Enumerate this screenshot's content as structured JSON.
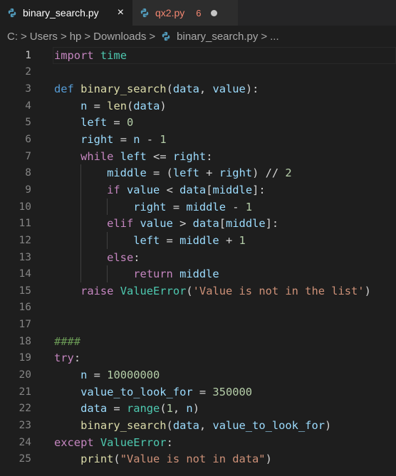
{
  "tabs": [
    {
      "label": "binary_search.py",
      "active": true,
      "close": "×"
    },
    {
      "label": "qx2.py",
      "active": false,
      "problems": "6",
      "modified": true
    }
  ],
  "breadcrumb": {
    "drive": "C:",
    "parts": [
      "Users",
      "hp",
      "Downloads",
      "binary_search.py",
      "..."
    ],
    "separator": ">"
  },
  "colors": {
    "keyword": "#569cd6",
    "control": "#c586c0",
    "function": "#dcdcaa",
    "variable": "#9cdcfe",
    "number": "#b5cea8",
    "string": "#ce9178",
    "class": "#4ec9b0",
    "comment": "#6a9955",
    "background": "#1e1e1e"
  },
  "icons": {
    "file_type": "python-icon"
  },
  "lines": [
    {
      "n": "1",
      "indent": 0,
      "tokens": [
        [
          "kc",
          "import"
        ],
        [
          "op",
          " "
        ],
        [
          "cl",
          "time"
        ]
      ]
    },
    {
      "n": "2",
      "indent": 0,
      "tokens": []
    },
    {
      "n": "3",
      "indent": 0,
      "tokens": [
        [
          "kw",
          "def"
        ],
        [
          "op",
          " "
        ],
        [
          "fn",
          "binary_search"
        ],
        [
          "op",
          "("
        ],
        [
          "vr",
          "data"
        ],
        [
          "op",
          ", "
        ],
        [
          "vr",
          "value"
        ],
        [
          "op",
          "):"
        ]
      ]
    },
    {
      "n": "4",
      "indent": 1,
      "tokens": [
        [
          "op",
          "    "
        ],
        [
          "vr",
          "n"
        ],
        [
          "op",
          " = "
        ],
        [
          "fn",
          "len"
        ],
        [
          "op",
          "("
        ],
        [
          "vr",
          "data"
        ],
        [
          "op",
          ")"
        ]
      ]
    },
    {
      "n": "5",
      "indent": 1,
      "tokens": [
        [
          "op",
          "    "
        ],
        [
          "vr",
          "left"
        ],
        [
          "op",
          " = "
        ],
        [
          "nm",
          "0"
        ]
      ]
    },
    {
      "n": "6",
      "indent": 1,
      "tokens": [
        [
          "op",
          "    "
        ],
        [
          "vr",
          "right"
        ],
        [
          "op",
          " = "
        ],
        [
          "vr",
          "n"
        ],
        [
          "op",
          " - "
        ],
        [
          "nm",
          "1"
        ]
      ]
    },
    {
      "n": "7",
      "indent": 1,
      "tokens": [
        [
          "op",
          "    "
        ],
        [
          "kc",
          "while"
        ],
        [
          "op",
          " "
        ],
        [
          "vr",
          "left"
        ],
        [
          "op",
          " <= "
        ],
        [
          "vr",
          "right"
        ],
        [
          "op",
          ":"
        ]
      ]
    },
    {
      "n": "8",
      "indent": 2,
      "tokens": [
        [
          "op",
          "        "
        ],
        [
          "vr",
          "middle"
        ],
        [
          "op",
          " = ("
        ],
        [
          "vr",
          "left"
        ],
        [
          "op",
          " + "
        ],
        [
          "vr",
          "right"
        ],
        [
          "op",
          ") // "
        ],
        [
          "nm",
          "2"
        ]
      ]
    },
    {
      "n": "9",
      "indent": 2,
      "tokens": [
        [
          "op",
          "        "
        ],
        [
          "kc",
          "if"
        ],
        [
          "op",
          " "
        ],
        [
          "vr",
          "value"
        ],
        [
          "op",
          " < "
        ],
        [
          "vr",
          "data"
        ],
        [
          "op",
          "["
        ],
        [
          "vr",
          "middle"
        ],
        [
          "op",
          "]:"
        ]
      ]
    },
    {
      "n": "10",
      "indent": 3,
      "tokens": [
        [
          "op",
          "            "
        ],
        [
          "vr",
          "right"
        ],
        [
          "op",
          " = "
        ],
        [
          "vr",
          "middle"
        ],
        [
          "op",
          " - "
        ],
        [
          "nm",
          "1"
        ]
      ]
    },
    {
      "n": "11",
      "indent": 2,
      "tokens": [
        [
          "op",
          "        "
        ],
        [
          "kc",
          "elif"
        ],
        [
          "op",
          " "
        ],
        [
          "vr",
          "value"
        ],
        [
          "op",
          " > "
        ],
        [
          "vr",
          "data"
        ],
        [
          "op",
          "["
        ],
        [
          "vr",
          "middle"
        ],
        [
          "op",
          "]:"
        ]
      ]
    },
    {
      "n": "12",
      "indent": 3,
      "tokens": [
        [
          "op",
          "            "
        ],
        [
          "vr",
          "left"
        ],
        [
          "op",
          " = "
        ],
        [
          "vr",
          "middle"
        ],
        [
          "op",
          " + "
        ],
        [
          "nm",
          "1"
        ]
      ]
    },
    {
      "n": "13",
      "indent": 2,
      "tokens": [
        [
          "op",
          "        "
        ],
        [
          "kc",
          "else"
        ],
        [
          "op",
          ":"
        ]
      ]
    },
    {
      "n": "14",
      "indent": 3,
      "tokens": [
        [
          "op",
          "            "
        ],
        [
          "kc",
          "return"
        ],
        [
          "op",
          " "
        ],
        [
          "vr",
          "middle"
        ]
      ]
    },
    {
      "n": "15",
      "indent": 1,
      "tokens": [
        [
          "op",
          "    "
        ],
        [
          "kc",
          "raise"
        ],
        [
          "op",
          " "
        ],
        [
          "cl",
          "ValueError"
        ],
        [
          "op",
          "("
        ],
        [
          "st",
          "'Value is not in the list'"
        ],
        [
          "op",
          ")"
        ]
      ]
    },
    {
      "n": "16",
      "indent": 0,
      "tokens": []
    },
    {
      "n": "17",
      "indent": 0,
      "tokens": []
    },
    {
      "n": "18",
      "indent": 0,
      "tokens": [
        [
          "cm",
          "####"
        ]
      ]
    },
    {
      "n": "19",
      "indent": 0,
      "tokens": [
        [
          "kc",
          "try"
        ],
        [
          "op",
          ":"
        ]
      ]
    },
    {
      "n": "20",
      "indent": 1,
      "tokens": [
        [
          "op",
          "    "
        ],
        [
          "vr",
          "n"
        ],
        [
          "op",
          " = "
        ],
        [
          "nm",
          "10000000"
        ]
      ]
    },
    {
      "n": "21",
      "indent": 1,
      "tokens": [
        [
          "op",
          "    "
        ],
        [
          "vr",
          "value_to_look_for"
        ],
        [
          "op",
          " = "
        ],
        [
          "nm",
          "350000"
        ]
      ]
    },
    {
      "n": "22",
      "indent": 1,
      "tokens": [
        [
          "op",
          "    "
        ],
        [
          "vr",
          "data"
        ],
        [
          "op",
          " = "
        ],
        [
          "cl",
          "range"
        ],
        [
          "op",
          "("
        ],
        [
          "nm",
          "1"
        ],
        [
          "op",
          ", "
        ],
        [
          "vr",
          "n"
        ],
        [
          "op",
          ")"
        ]
      ]
    },
    {
      "n": "23",
      "indent": 1,
      "tokens": [
        [
          "op",
          "    "
        ],
        [
          "fn",
          "binary_search"
        ],
        [
          "op",
          "("
        ],
        [
          "vr",
          "data"
        ],
        [
          "op",
          ", "
        ],
        [
          "vr",
          "value_to_look_for"
        ],
        [
          "op",
          ")"
        ]
      ]
    },
    {
      "n": "24",
      "indent": 0,
      "tokens": [
        [
          "kc",
          "except"
        ],
        [
          "op",
          " "
        ],
        [
          "cl",
          "ValueError"
        ],
        [
          "op",
          ":"
        ]
      ]
    },
    {
      "n": "25",
      "indent": 1,
      "tokens": [
        [
          "op",
          "    "
        ],
        [
          "fn",
          "print"
        ],
        [
          "op",
          "("
        ],
        [
          "st",
          "\"Value is not in data\""
        ],
        [
          "op",
          ")"
        ]
      ]
    }
  ]
}
